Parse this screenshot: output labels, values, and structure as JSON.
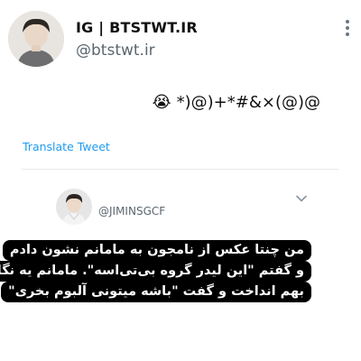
{
  "profile": {
    "display_name": "IG | BTSTWT.IR",
    "handle": "@btstwt.ir",
    "avatar_icon": "profile-photo"
  },
  "tweet": {
    "text": "*)@)+*#&×(@)@",
    "emoji": "😭",
    "translate_label": "Translate Tweet"
  },
  "quoted": {
    "handle": "@JIMINSGCF",
    "avatar_icon": "profile-photo",
    "menu_icon": "chevron-down-icon"
  },
  "caption": {
    "lines": [
      "من چنتا عکس از نامجون به مامانم نشون دادم",
      "و گفتم \"این لیدر گروه بی‌تی‌اسه\". مامانم یه نگاه",
      "بهم انداخت و گفت \"باشه میتونی آلبوم بخری\""
    ]
  },
  "colors": {
    "link": "#1d9bf0",
    "muted": "#5b6670",
    "caption_bg": "#000000",
    "caption_text": "#ffffff"
  }
}
